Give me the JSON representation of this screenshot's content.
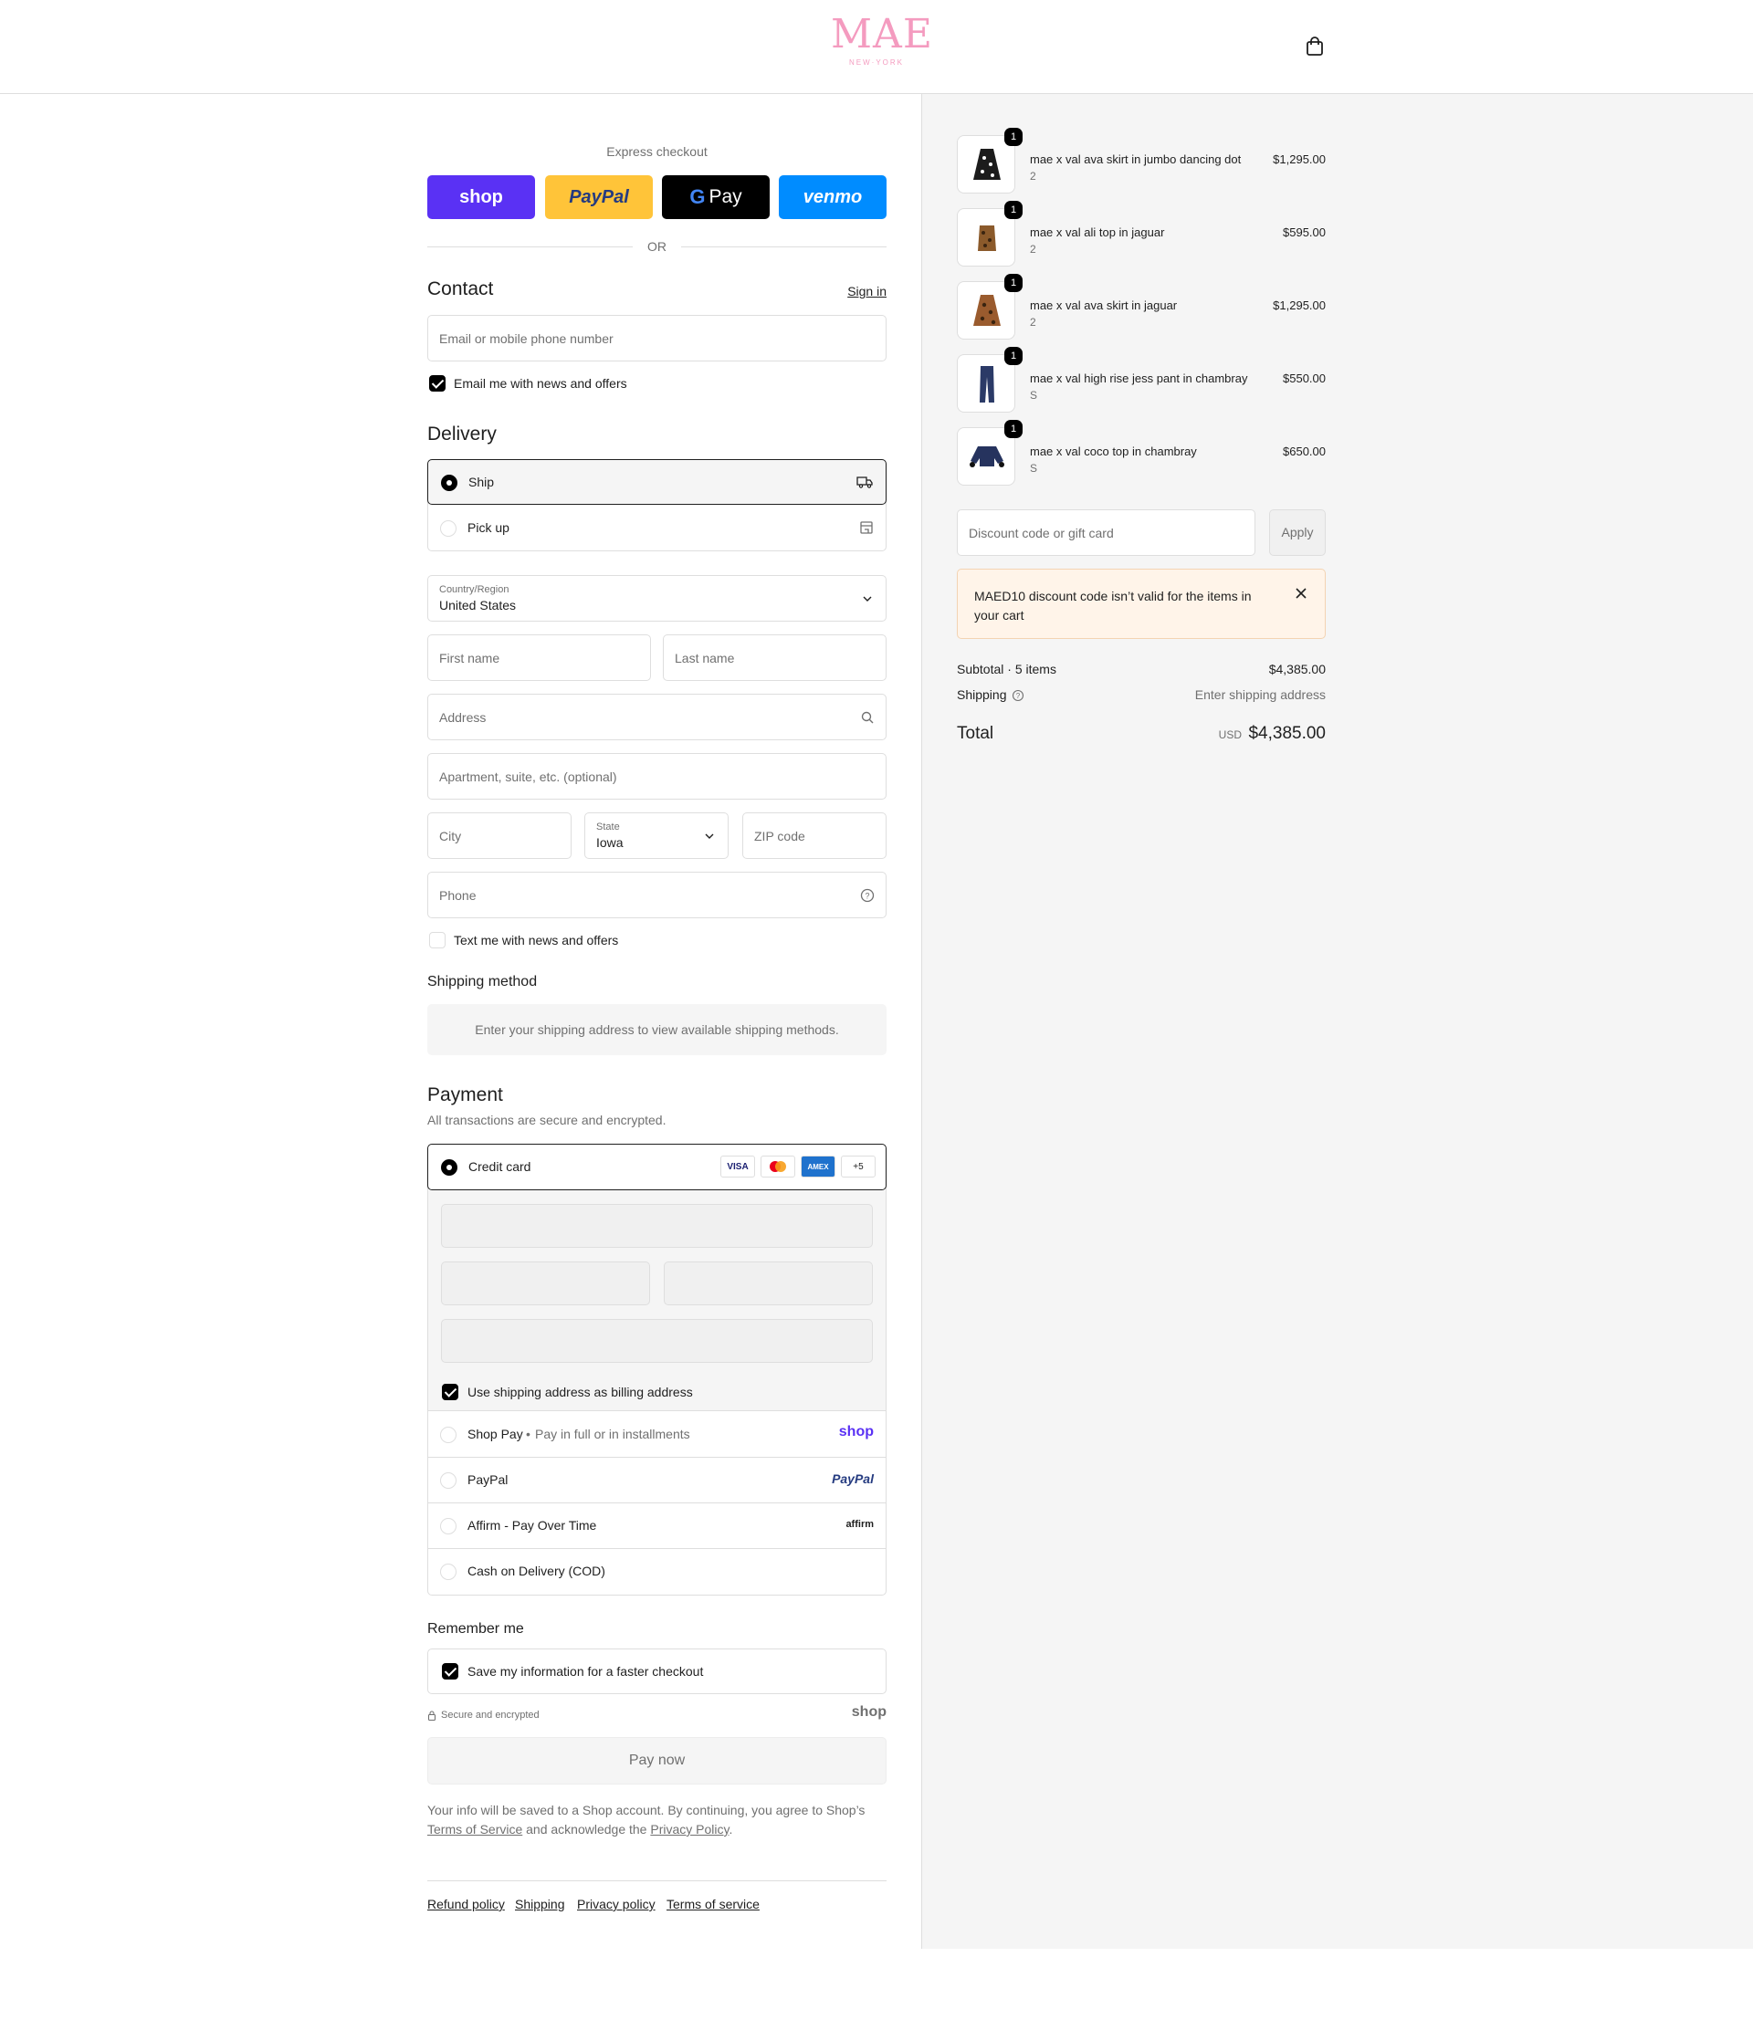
{
  "header": {
    "logo_text": "MAE",
    "logo_sub": "NEW·YORK",
    "cart_icon": "shopping-bag-icon"
  },
  "express": {
    "title": "Express checkout",
    "or": "OR",
    "buttons": [
      {
        "label": "shop",
        "color": "#5a31f4"
      },
      {
        "label": "PayPal",
        "color": "#ffc439"
      },
      {
        "label": "Pay",
        "color": "#000000"
      },
      {
        "label": "venmo",
        "color": "#008cff"
      }
    ]
  },
  "contact": {
    "heading": "Contact",
    "sign_in": "Sign in",
    "email_placeholder": "Email or mobile phone number",
    "email_news_label": "Email me with news and offers",
    "email_news_checked": true
  },
  "delivery": {
    "heading": "Delivery",
    "options": [
      {
        "label": "Ship",
        "selected": true,
        "icon": "truck-icon"
      },
      {
        "label": "Pick up",
        "selected": false,
        "icon": "store-icon"
      }
    ],
    "country_label": "Country/Region",
    "country_value": "United States",
    "first_name": "First name",
    "last_name": "Last name",
    "address": "Address",
    "apartment": "Apartment, suite, etc. (optional)",
    "city": "City",
    "state_label": "State",
    "state_value": "Iowa",
    "zip": "ZIP code",
    "phone": "Phone",
    "text_news_label": "Text me with news and offers",
    "text_news_checked": false
  },
  "shipping_method": {
    "heading": "Shipping method",
    "notice": "Enter your shipping address to view available shipping methods."
  },
  "payment": {
    "heading": "Payment",
    "subtitle": "All transactions are secure and encrypted.",
    "credit_card_label": "Credit card",
    "card_icons": [
      "VISA",
      "MC",
      "AMEX",
      "+5"
    ],
    "billing_label": "Use shipping address as billing address",
    "billing_checked": true,
    "methods": [
      {
        "label": "Shop Pay",
        "sub": "Pay in full or in installments",
        "logo": "shop"
      },
      {
        "label": "PayPal",
        "sub": "",
        "logo": "PayPal"
      },
      {
        "label": "Affirm - Pay Over Time",
        "sub": "",
        "logo": "affirm"
      },
      {
        "label": "Cash on Delivery (COD)",
        "sub": "",
        "logo": ""
      }
    ]
  },
  "remember": {
    "heading": "Remember me",
    "save_label": "Save my information for a faster checkout",
    "save_checked": true,
    "secure_text": "Secure and encrypted",
    "shop_logo": "shop"
  },
  "pay_now": "Pay now",
  "legal": {
    "before": "Your info will be saved to a Shop account. By continuing, you agree to Shop’s",
    "tos": "Terms of Service",
    "mid": "and acknowledge the",
    "privacy": "Privacy Policy",
    "after": "."
  },
  "footer_links": [
    "Refund policy",
    "Shipping",
    "Privacy policy",
    "Terms of service"
  ],
  "cart": {
    "items": [
      {
        "name": "mae x val ava skirt in jumbo dancing dot",
        "variant": "2",
        "price": "$1,295.00",
        "qty": "1"
      },
      {
        "name": "mae x val ali top in jaguar",
        "variant": "2",
        "price": "$595.00",
        "qty": "1"
      },
      {
        "name": "mae x val ava skirt in jaguar",
        "variant": "2",
        "price": "$1,295.00",
        "qty": "1"
      },
      {
        "name": "mae x val high rise jess pant in chambray",
        "variant": "S",
        "price": "$550.00",
        "qty": "1"
      },
      {
        "name": "mae x val coco top in chambray",
        "variant": "S",
        "price": "$650.00",
        "qty": "1"
      }
    ],
    "discount_placeholder": "Discount code or gift card",
    "apply": "Apply",
    "error": "MAED10 discount code isn’t valid for the items in your cart",
    "subtotal_label": "Subtotal · 5 items",
    "subtotal_value": "$4,385.00",
    "shipping_label": "Shipping",
    "shipping_value": "Enter shipping address",
    "total_label": "Total",
    "currency": "USD",
    "total_value": "$4,385.00"
  }
}
